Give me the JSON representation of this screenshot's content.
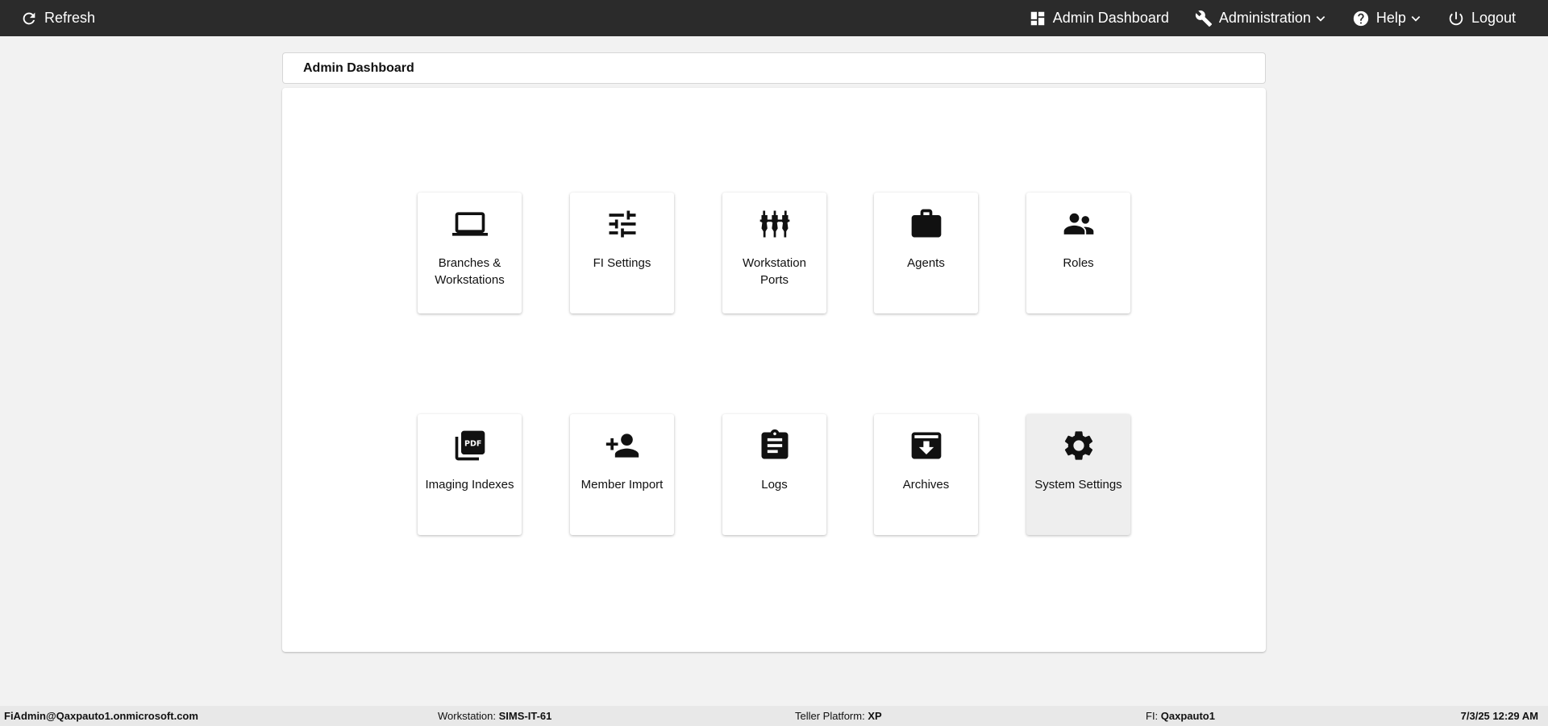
{
  "topbar": {
    "refresh_label": "Refresh",
    "nav": {
      "dashboard_label": "Admin Dashboard",
      "administration_label": "Administration",
      "help_label": "Help",
      "logout_label": "Logout"
    }
  },
  "page": {
    "title": "Admin Dashboard"
  },
  "tiles": [
    {
      "label": "Branches & Workstations",
      "icon": "laptop-icon"
    },
    {
      "label": "FI Settings",
      "icon": "tune-icon"
    },
    {
      "label": "Workstation Ports",
      "icon": "ports-icon"
    },
    {
      "label": "Agents",
      "icon": "briefcase-icon"
    },
    {
      "label": "Roles",
      "icon": "people-icon"
    },
    {
      "label": "Imaging Indexes",
      "icon": "pdf-icon"
    },
    {
      "label": "Member Import",
      "icon": "add-person-icon"
    },
    {
      "label": "Logs",
      "icon": "clipboard-icon"
    },
    {
      "label": "Archives",
      "icon": "archive-icon"
    },
    {
      "label": "System Settings",
      "icon": "gear-icon"
    }
  ],
  "footer": {
    "user": "FiAdmin@Qaxpauto1.onmicrosoft.com",
    "workstation_label": "Workstation:",
    "workstation_value": "SIMS-IT-61",
    "platform_label": "Teller Platform:",
    "platform_value": "XP",
    "fi_label": "FI:",
    "fi_value": "Qaxpauto1",
    "datetime": "7/3/25 12:29 AM"
  }
}
